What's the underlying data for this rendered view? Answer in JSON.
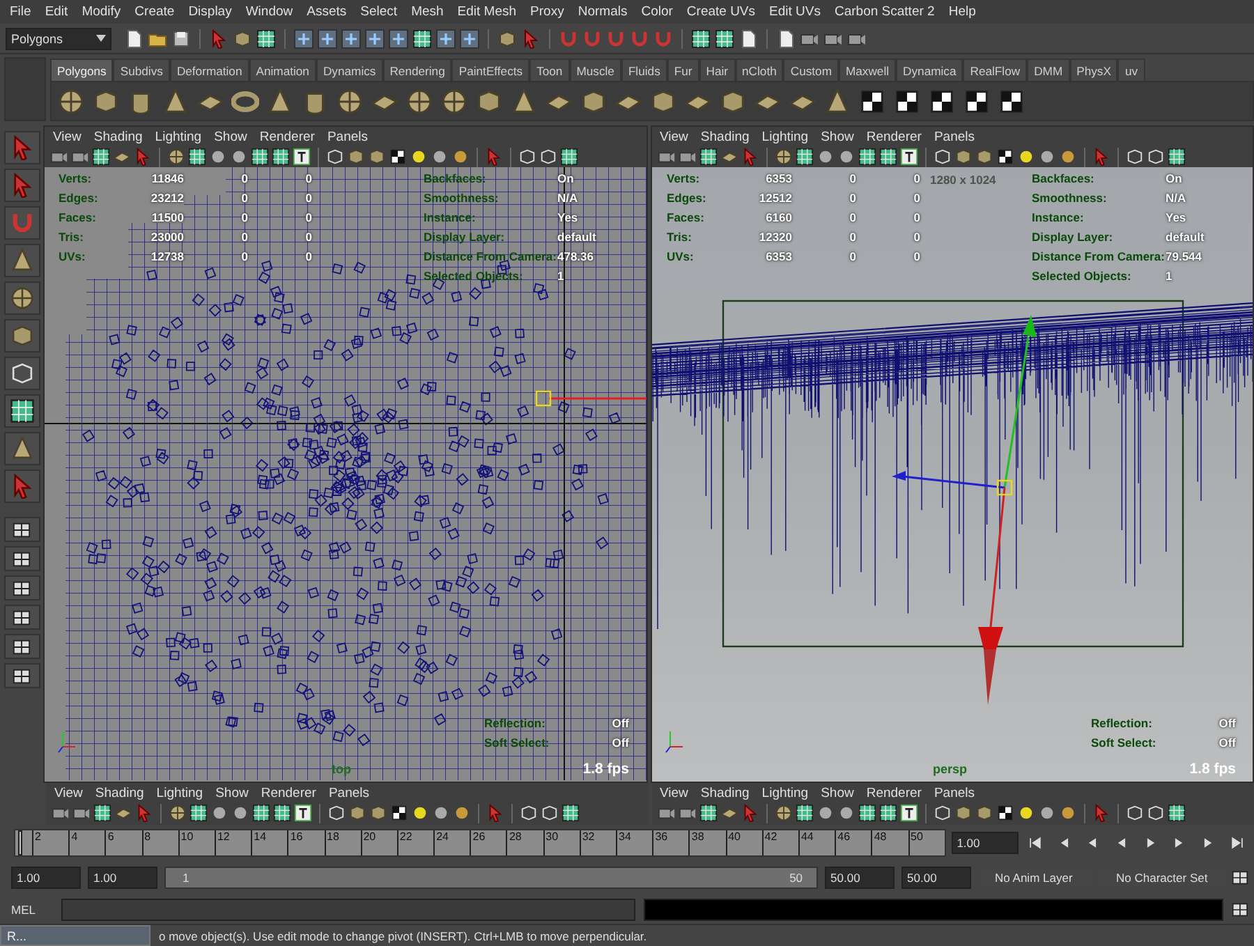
{
  "menu_bar": [
    "File",
    "Edit",
    "Modify",
    "Create",
    "Display",
    "Window",
    "Assets",
    "Select",
    "Mesh",
    "Edit Mesh",
    "Proxy",
    "Normals",
    "Color",
    "Create UVs",
    "Edit UVs",
    "Carbon Scatter 2",
    "Help"
  ],
  "status_line": {
    "menu_set": "Polygons"
  },
  "shelf": {
    "tabs": [
      {
        "label": "Polygons",
        "selected": true
      },
      {
        "label": "Subdivs",
        "selected": false
      },
      {
        "label": "Deformation",
        "selected": false
      },
      {
        "label": "Animation",
        "selected": false
      },
      {
        "label": "Dynamics",
        "selected": false
      },
      {
        "label": "Rendering",
        "selected": false
      },
      {
        "label": "PaintEffects",
        "selected": false
      },
      {
        "label": "Toon",
        "selected": false
      },
      {
        "label": "Muscle",
        "selected": false
      },
      {
        "label": "Fluids",
        "selected": false
      },
      {
        "label": "Fur",
        "selected": false
      },
      {
        "label": "Hair",
        "selected": false
      },
      {
        "label": "nCloth",
        "selected": false
      },
      {
        "label": "Custom",
        "selected": false
      },
      {
        "label": "Maxwell",
        "selected": false
      },
      {
        "label": "Dynamica",
        "selected": false
      },
      {
        "label": "RealFlow",
        "selected": false
      },
      {
        "label": "DMM",
        "selected": false
      },
      {
        "label": "PhysX",
        "selected": false
      },
      {
        "label": "uv",
        "selected": false
      }
    ]
  },
  "viewports": [
    {
      "kind": "top",
      "camera": "top",
      "menus": [
        "View",
        "Shading",
        "Lighting",
        "Show",
        "Renderer",
        "Panels"
      ],
      "stats": [
        {
          "label": "Verts:",
          "values": [
            "11846",
            "0",
            "0"
          ]
        },
        {
          "label": "Edges:",
          "values": [
            "23212",
            "0",
            "0"
          ]
        },
        {
          "label": "Faces:",
          "values": [
            "11500",
            "0",
            "0"
          ]
        },
        {
          "label": "Tris:",
          "values": [
            "23000",
            "0",
            "0"
          ]
        },
        {
          "label": "UVs:",
          "values": [
            "12738",
            "0",
            "0"
          ]
        }
      ],
      "info": [
        {
          "label": "Backfaces:",
          "value": "On"
        },
        {
          "label": "Smoothness:",
          "value": "N/A"
        },
        {
          "label": "Instance:",
          "value": "Yes"
        },
        {
          "label": "Display Layer:",
          "value": "default"
        },
        {
          "label": "Distance From Camera:",
          "value": "478.36"
        },
        {
          "label": "Selected Objects:",
          "value": "1"
        }
      ],
      "display": [
        {
          "label": "Reflection:",
          "value": "Off"
        },
        {
          "label": "Soft Select:",
          "value": "Off"
        }
      ],
      "fps": "1.8 fps"
    },
    {
      "kind": "perspective",
      "camera": "persp",
      "menus": [
        "View",
        "Shading",
        "Lighting",
        "Show",
        "Renderer",
        "Panels"
      ],
      "resolution": "1280 x 1024",
      "stats": [
        {
          "label": "Verts:",
          "values": [
            "6353",
            "0",
            "0"
          ]
        },
        {
          "label": "Edges:",
          "values": [
            "12512",
            "0",
            "0"
          ]
        },
        {
          "label": "Faces:",
          "values": [
            "6160",
            "0",
            "0"
          ]
        },
        {
          "label": "Tris:",
          "values": [
            "12320",
            "0",
            "0"
          ]
        },
        {
          "label": "UVs:",
          "values": [
            "6353",
            "0",
            "0"
          ]
        }
      ],
      "info": [
        {
          "label": "Backfaces:",
          "value": "On"
        },
        {
          "label": "Smoothness:",
          "value": "N/A"
        },
        {
          "label": "Instance:",
          "value": "Yes"
        },
        {
          "label": "Display Layer:",
          "value": "default"
        },
        {
          "label": "Distance From Camera:",
          "value": "79.544"
        },
        {
          "label": "Selected Objects:",
          "value": "1"
        }
      ],
      "display": [
        {
          "label": "Reflection:",
          "value": "Off"
        },
        {
          "label": "Soft Select:",
          "value": "Off"
        }
      ],
      "fps": "1.8 fps"
    }
  ],
  "lower_panels": [
    {
      "menus": [
        "View",
        "Shading",
        "Lighting",
        "Show",
        "Renderer",
        "Panels"
      ]
    },
    {
      "menus": [
        "View",
        "Shading",
        "Lighting",
        "Show",
        "Renderer",
        "Panels"
      ]
    }
  ],
  "time_slider": {
    "ticks": [
      "2",
      "4",
      "6",
      "8",
      "10",
      "12",
      "14",
      "16",
      "18",
      "20",
      "22",
      "24",
      "26",
      "28",
      "30",
      "32",
      "34",
      "36",
      "38",
      "40",
      "42",
      "44",
      "46",
      "48",
      "50"
    ],
    "current_frame": "1.00",
    "level": 0
  },
  "range_slider": {
    "level": 1,
    "start": "1.00",
    "playback_start": "1.00",
    "range_start": "1",
    "range_end": "50",
    "playback_end": "50.00",
    "end": "50.00",
    "anim_layer": "No Anim Layer",
    "character_set": "No Character Set"
  },
  "command_line": {
    "label": "MEL"
  },
  "minimized_window": {
    "title": "R..."
  },
  "help_line": "o move object(s). Use edit mode to change pivot (INSERT).  Ctrl+LMB to move perpendicular."
}
